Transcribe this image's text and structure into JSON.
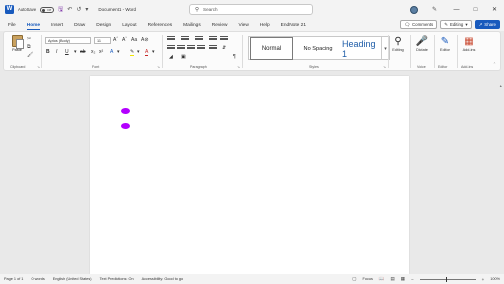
{
  "app": {
    "autosave_label": "AutoSave",
    "autosave_state": "Off",
    "document_title": "Document1 - Word"
  },
  "search": {
    "placeholder": "Search"
  },
  "tabs": [
    "File",
    "Home",
    "Insert",
    "Draw",
    "Design",
    "Layout",
    "References",
    "Mailings",
    "Review",
    "View",
    "Help",
    "EndNote 21"
  ],
  "tabs_right": {
    "comments": "Comments",
    "editing": "Editing",
    "share": "Share"
  },
  "ribbon": {
    "clipboard": {
      "paste": "Paste",
      "label": "Clipboard"
    },
    "font": {
      "name": "Aptos (Body)",
      "size": "11",
      "label": "Font"
    },
    "paragraph": {
      "label": "Paragraph"
    },
    "styles": {
      "items": [
        "Normal",
        "No Spacing",
        "Heading 1"
      ],
      "label": "Styles"
    },
    "editing": {
      "label": "Editing"
    },
    "voice": {
      "dictate": "Dictate",
      "label": "Voice"
    },
    "editor": {
      "editor": "Editor",
      "label": "Editor"
    },
    "addins": {
      "addins": "Add-ins",
      "label": "Add-ins"
    }
  },
  "status": {
    "page": "Page 1 of 1",
    "words": "0 words",
    "language": "English (United States)",
    "text_predictions": "Text Predictions: On",
    "accessibility": "Accessibility: Good to go",
    "focus": "Focus",
    "zoom": "100%"
  },
  "colors": {
    "accent": "#185abd",
    "ink_marks": "#b300ff"
  }
}
